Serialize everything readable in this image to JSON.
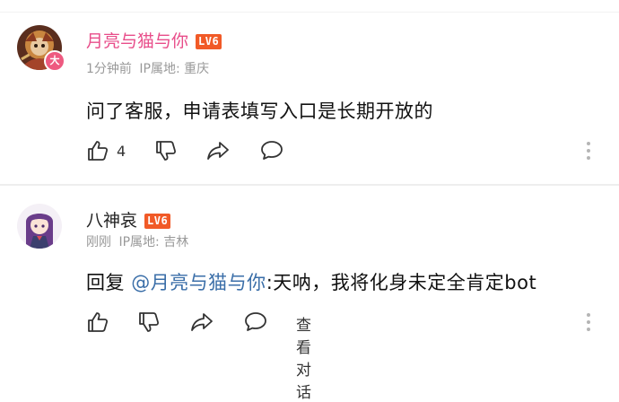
{
  "comments": [
    {
      "username": "月亮与猫与你",
      "level": "LV6",
      "avatar_badge": "大",
      "time": "1分钟前",
      "ip_label": "IP属地:",
      "ip_location": "重庆",
      "text": "问了客服，申请表填写入口是长期开放的",
      "like_count": "4",
      "icons": [
        "thumbs-up-icon",
        "thumbs-down-icon",
        "share-icon",
        "reply-icon",
        "more-vertical-icon"
      ]
    },
    {
      "username": "八神哀",
      "level": "LV6",
      "time": "刚刚",
      "ip_label": "IP属地:",
      "ip_location": "吉林",
      "reply_prefix": "回复 ",
      "mention": "@月亮与猫与你",
      "text": ":天呐，我将化身未定全肯定bot",
      "view_replies_label": "查看对话",
      "icons": [
        "thumbs-up-icon",
        "thumbs-down-icon",
        "share-icon",
        "reply-icon",
        "more-vertical-icon"
      ]
    }
  ],
  "colors": {
    "username_vip": "#e84d8a",
    "level_badge": "#f15a27",
    "mention": "#3a6ea8",
    "meta": "#999999"
  }
}
